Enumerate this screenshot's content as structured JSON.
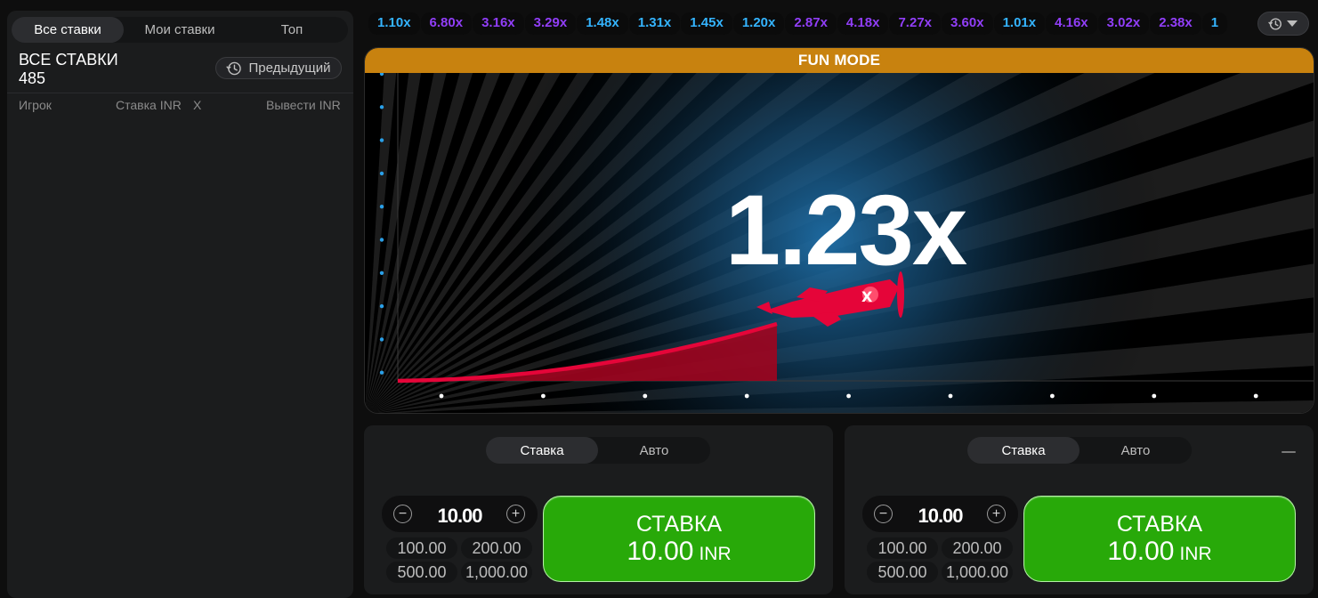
{
  "left_panel": {
    "tabs": [
      "Все ставки",
      "Мои ставки",
      "Топ"
    ],
    "title": "ВСЕ СТАВКИ",
    "count": "485",
    "prev_button": "Предыдущий",
    "columns": [
      "Игрок",
      "Ставка INR",
      "X",
      "Вывести INR"
    ]
  },
  "history": [
    {
      "value": "1.10x",
      "color": "#34b4ff"
    },
    {
      "value": "6.80x",
      "color": "#913ef8"
    },
    {
      "value": "3.16x",
      "color": "#913ef8"
    },
    {
      "value": "3.29x",
      "color": "#913ef8"
    },
    {
      "value": "1.48x",
      "color": "#34b4ff"
    },
    {
      "value": "1.31x",
      "color": "#34b4ff"
    },
    {
      "value": "1.45x",
      "color": "#34b4ff"
    },
    {
      "value": "1.20x",
      "color": "#34b4ff"
    },
    {
      "value": "2.87x",
      "color": "#913ef8"
    },
    {
      "value": "4.18x",
      "color": "#913ef8"
    },
    {
      "value": "7.27x",
      "color": "#913ef8"
    },
    {
      "value": "3.60x",
      "color": "#913ef8"
    },
    {
      "value": "1.01x",
      "color": "#34b4ff"
    },
    {
      "value": "4.16x",
      "color": "#913ef8"
    },
    {
      "value": "3.02x",
      "color": "#913ef8"
    },
    {
      "value": "2.38x",
      "color": "#913ef8"
    },
    {
      "value": "1",
      "color": "#34b4ff"
    }
  ],
  "game": {
    "banner": "FUN MODE",
    "multiplier": "1.23x",
    "banner_color": "#c8820f",
    "curve_color": "#e50539"
  },
  "bet_panels": [
    {
      "tabs": [
        "Ставка",
        "Авто"
      ],
      "amount": "10.00",
      "quick_amounts": [
        "100.00",
        "200.00",
        "500.00",
        "1,000.00"
      ],
      "button_label": "СТАВКА",
      "button_amount": "10.00",
      "button_currency": "INR"
    },
    {
      "tabs": [
        "Ставка",
        "Авто"
      ],
      "amount": "10.00",
      "quick_amounts": [
        "100.00",
        "200.00",
        "500.00",
        "1,000.00"
      ],
      "button_label": "СТАВКА",
      "button_amount": "10.00",
      "button_currency": "INR"
    }
  ]
}
